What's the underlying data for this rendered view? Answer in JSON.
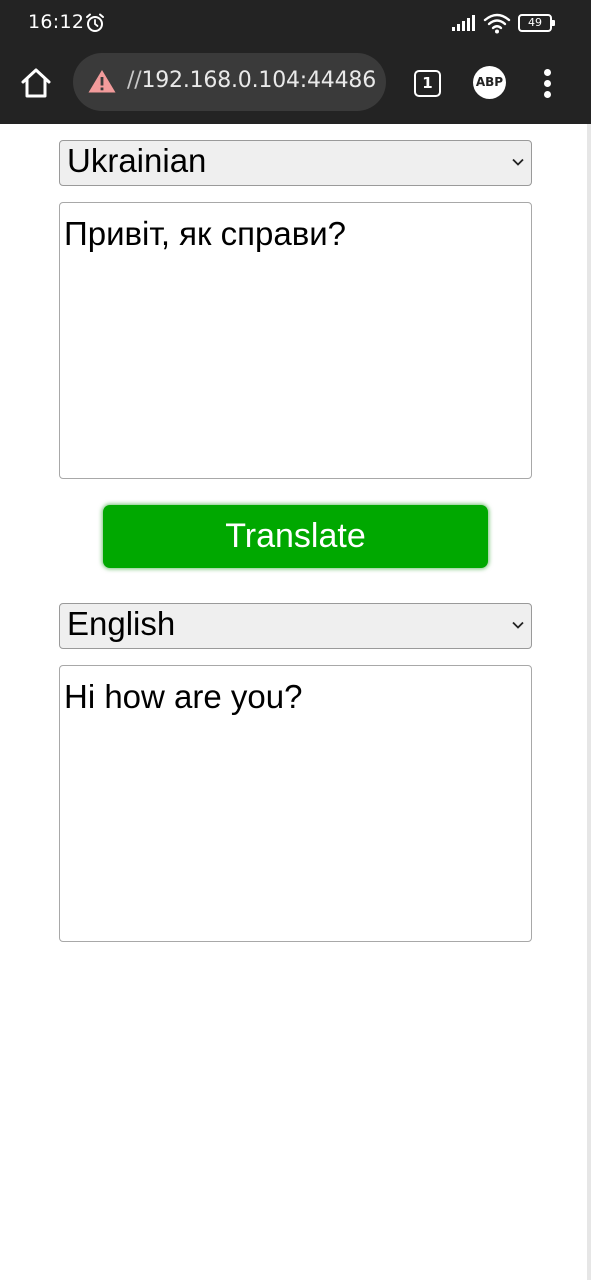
{
  "status_bar": {
    "time": "16:12",
    "battery": "49",
    "icons": [
      "alarm-icon",
      "signal-icon",
      "wifi-icon",
      "battery-icon"
    ]
  },
  "browser": {
    "url_prefix": "//",
    "url_host": "192.168.0.104:44486",
    "tab_count": "1",
    "adblock_label": "ABP",
    "icons": [
      "home-icon",
      "not-secure-warning-icon",
      "tab-switcher-icon",
      "adblock-icon",
      "more-vert-icon"
    ]
  },
  "translator": {
    "source_language": "Ukrainian",
    "source_text": "Привіт, як справи?",
    "translate_label": "Translate",
    "target_language": "English",
    "target_text": "Hi how are you?"
  },
  "colors": {
    "bar_background": "#232323",
    "urlbar_background": "#3a3a3a",
    "warning": "#f29b9b",
    "translate_button": "#00a800",
    "select_background": "#efefef"
  }
}
